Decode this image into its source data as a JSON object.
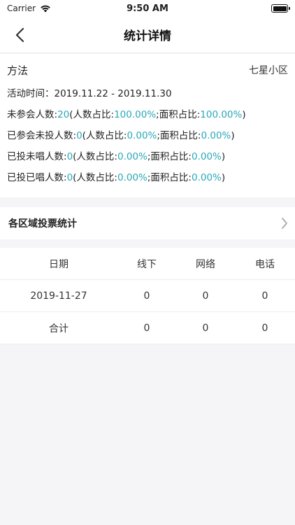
{
  "status_bar": {
    "carrier": "Carrier",
    "time": "9:50 AM"
  },
  "nav": {
    "title": "统计详情"
  },
  "summary": {
    "method_label": "方法",
    "community": "七星小区",
    "activity_time_label": "活动时间：",
    "activity_time_value": "2019.11.22 - 2019.11.30",
    "lines": [
      {
        "label": "未参会人数:",
        "count": "20",
        "ratio_label": "(人数占比:",
        "ratio": "100.00%",
        "area_label": ";面积占比:",
        "area": "100.00%",
        "close": ")"
      },
      {
        "label": "已参会未投人数:",
        "count": "0",
        "ratio_label": "(人数占比:",
        "ratio": "0.00%",
        "area_label": ";面积占比:",
        "area": "0.00%",
        "close": ")"
      },
      {
        "label": "已投未唱人数:",
        "count": "0",
        "ratio_label": "(人数占比:",
        "ratio": "0.00%",
        "area_label": ";面积占比:",
        "area": "0.00%",
        "close": ")"
      },
      {
        "label": "已投已唱人数:",
        "count": "0",
        "ratio_label": "(人数占比:",
        "ratio": "0.00%",
        "area_label": ";面积占比:",
        "area": "0.00%",
        "close": ")"
      }
    ]
  },
  "region": {
    "label": "各区域投票统计"
  },
  "table": {
    "headers": [
      "日期",
      "线下",
      "网络",
      "电话"
    ],
    "rows": [
      [
        "2019-11-27",
        "0",
        "0",
        "0"
      ],
      [
        "合计",
        "0",
        "0",
        "0"
      ]
    ]
  },
  "colors": {
    "highlight": "#28a8b8"
  }
}
